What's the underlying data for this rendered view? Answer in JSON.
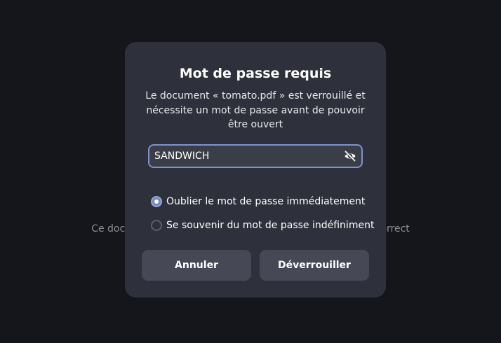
{
  "background": {
    "message": "Ce document est verrouillé et nécessite un mot de passe correct"
  },
  "dialog": {
    "title": "Mot de passe requis",
    "body": "Le document « tomato.pdf » est verrouillé et nécessite un mot de passe avant de pouvoir être ouvert",
    "password_value": "SANDWICH",
    "reveal_icon": "eye-slash-icon",
    "options": [
      {
        "label": "Oublier le mot de passe immédiatement",
        "selected": true
      },
      {
        "label": "Se souvenir du mot de passe indéfiniment",
        "selected": false
      }
    ],
    "cancel_label": "Annuler",
    "unlock_label": "Déverrouiller"
  },
  "colors": {
    "background": "#15151c",
    "dialog": "#2e313b",
    "accent": "#7688c0",
    "button": "#464955",
    "field_border": "#7f93c9"
  }
}
